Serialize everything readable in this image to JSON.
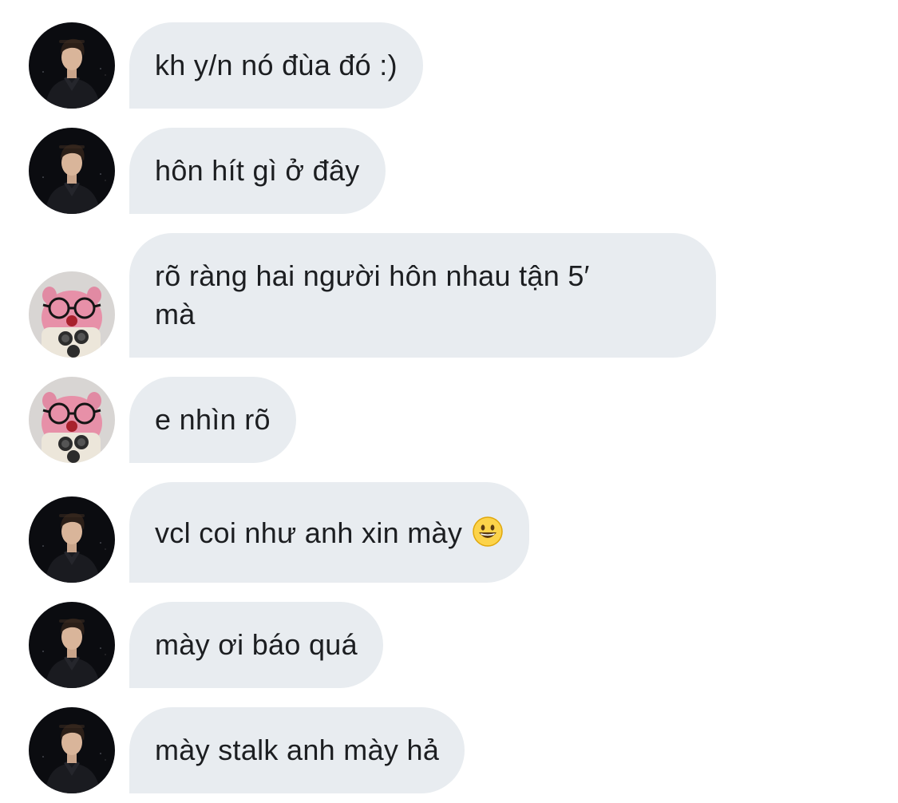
{
  "messages": [
    {
      "sender": "man-avatar",
      "text": "kh y/n nó đùa đó :)"
    },
    {
      "sender": "man-avatar",
      "text": "hôn hít gì ở đây"
    },
    {
      "sender": "pig-avatar",
      "text": "rõ ràng hai người hôn nhau tận 5′\nmà"
    },
    {
      "sender": "pig-avatar",
      "text": "e nhìn rõ"
    },
    {
      "sender": "man-avatar",
      "text": "vcl coi như anh xin mày ",
      "emoji": "grinning-face-emoji"
    },
    {
      "sender": "man-avatar",
      "text": "mày ơi báo quá"
    },
    {
      "sender": "man-avatar",
      "text": "mày stalk anh mày hả"
    }
  ],
  "colors": {
    "bubble_bg": "#e8ecf0",
    "text": "#1c1e21",
    "background": "#ffffff"
  }
}
